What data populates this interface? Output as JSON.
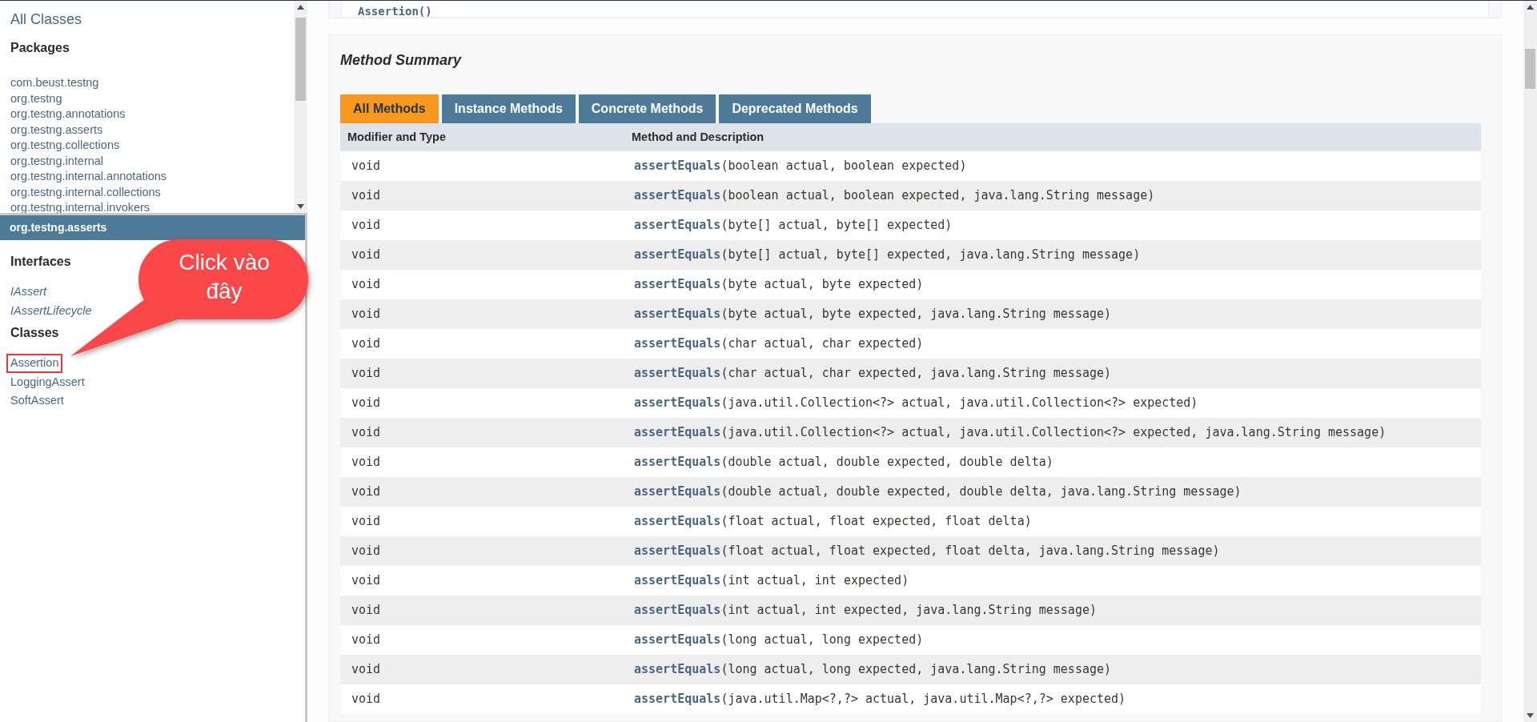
{
  "left_top": {
    "title": "All Classes",
    "heading": "Packages",
    "packages": [
      "com.beust.testng",
      "org.testng",
      "org.testng.annotations",
      "org.testng.asserts",
      "org.testng.collections",
      "org.testng.internal",
      "org.testng.internal.annotations",
      "org.testng.internal.collections",
      "org.testng.internal.invokers"
    ]
  },
  "left_bottom": {
    "package": "org.testng.asserts",
    "sections": [
      {
        "heading": "Interfaces",
        "items": [
          {
            "label": "IAssert",
            "kind": "interface",
            "highlighted": false
          },
          {
            "label": "IAssertLifecycle",
            "kind": "interface",
            "highlighted": false
          }
        ]
      },
      {
        "heading": "Classes",
        "items": [
          {
            "label": "Assertion",
            "kind": "class",
            "highlighted": true
          },
          {
            "label": "LoggingAssert",
            "kind": "class",
            "highlighted": false
          },
          {
            "label": "SoftAssert",
            "kind": "class",
            "highlighted": false
          }
        ]
      }
    ]
  },
  "callout": {
    "text": "Click vào đây"
  },
  "constructor_stub": "Assertion()",
  "method_summary": {
    "title": "Method Summary",
    "tabs": [
      {
        "label": "All Methods",
        "selected": true
      },
      {
        "label": "Instance Methods",
        "selected": false
      },
      {
        "label": "Concrete Methods",
        "selected": false
      },
      {
        "label": "Deprecated Methods",
        "selected": false
      }
    ],
    "columns": [
      "Modifier and Type",
      "Method and Description"
    ],
    "rows": [
      {
        "type": "void",
        "name": "assertEquals",
        "params": "(boolean actual, boolean expected)"
      },
      {
        "type": "void",
        "name": "assertEquals",
        "params": "(boolean actual, boolean expected, java.lang.String message)"
      },
      {
        "type": "void",
        "name": "assertEquals",
        "params": "(byte[] actual, byte[] expected)"
      },
      {
        "type": "void",
        "name": "assertEquals",
        "params": "(byte[] actual, byte[] expected, java.lang.String message)"
      },
      {
        "type": "void",
        "name": "assertEquals",
        "params": "(byte actual, byte expected)"
      },
      {
        "type": "void",
        "name": "assertEquals",
        "params": "(byte actual, byte expected, java.lang.String message)"
      },
      {
        "type": "void",
        "name": "assertEquals",
        "params": "(char actual, char expected)"
      },
      {
        "type": "void",
        "name": "assertEquals",
        "params": "(char actual, char expected, java.lang.String message)"
      },
      {
        "type": "void",
        "name": "assertEquals",
        "params": "(java.util.Collection<?> actual, java.util.Collection<?> expected)"
      },
      {
        "type": "void",
        "name": "assertEquals",
        "params": "(java.util.Collection<?> actual, java.util.Collection<?> expected, java.lang.String message)"
      },
      {
        "type": "void",
        "name": "assertEquals",
        "params": "(double actual, double expected, double delta)"
      },
      {
        "type": "void",
        "name": "assertEquals",
        "params": "(double actual, double expected, double delta, java.lang.String message)"
      },
      {
        "type": "void",
        "name": "assertEquals",
        "params": "(float actual, float expected, float delta)"
      },
      {
        "type": "void",
        "name": "assertEquals",
        "params": "(float actual, float expected, float delta, java.lang.String message)"
      },
      {
        "type": "void",
        "name": "assertEquals",
        "params": "(int actual, int expected)"
      },
      {
        "type": "void",
        "name": "assertEquals",
        "params": "(int actual, int expected, java.lang.String message)"
      },
      {
        "type": "void",
        "name": "assertEquals",
        "params": "(long actual, long expected)"
      },
      {
        "type": "void",
        "name": "assertEquals",
        "params": "(long actual, long expected, java.lang.String message)"
      },
      {
        "type": "void",
        "name": "assertEquals",
        "params": "(java.util.Map<?,?> actual, java.util.Map<?,?> expected)"
      }
    ]
  }
}
